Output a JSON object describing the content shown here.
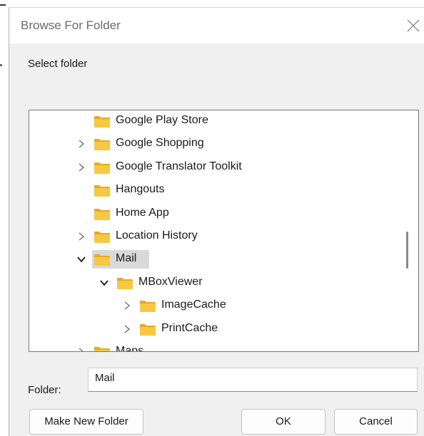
{
  "dialog": {
    "title": "Browse For Folder",
    "prompt": "Select folder"
  },
  "tree": {
    "items": [
      {
        "label": "Google Play Store",
        "expander": "none"
      },
      {
        "label": "Google Shopping",
        "expander": "collapsed"
      },
      {
        "label": "Google Translator Toolkit",
        "expander": "collapsed"
      },
      {
        "label": "Hangouts",
        "expander": "none"
      },
      {
        "label": "Home App",
        "expander": "none"
      },
      {
        "label": "Location History",
        "expander": "collapsed"
      },
      {
        "label": "Mail",
        "expander": "expanded",
        "selected": true
      },
      {
        "label": "MBoxViewer",
        "expander": "expanded"
      },
      {
        "label": "ImageCache",
        "expander": "collapsed"
      },
      {
        "label": "PrintCache",
        "expander": "collapsed"
      },
      {
        "label": "Maps",
        "expander": "collapsed"
      }
    ]
  },
  "folder_field": {
    "label": "Folder:",
    "value": "Mail"
  },
  "buttons": {
    "make_new_folder": "Make New Folder",
    "ok": "OK",
    "cancel": "Cancel"
  },
  "colors": {
    "folder_body": "#f7c843",
    "folder_tab": "#e8a91e",
    "selection": "#d9d9d9"
  }
}
